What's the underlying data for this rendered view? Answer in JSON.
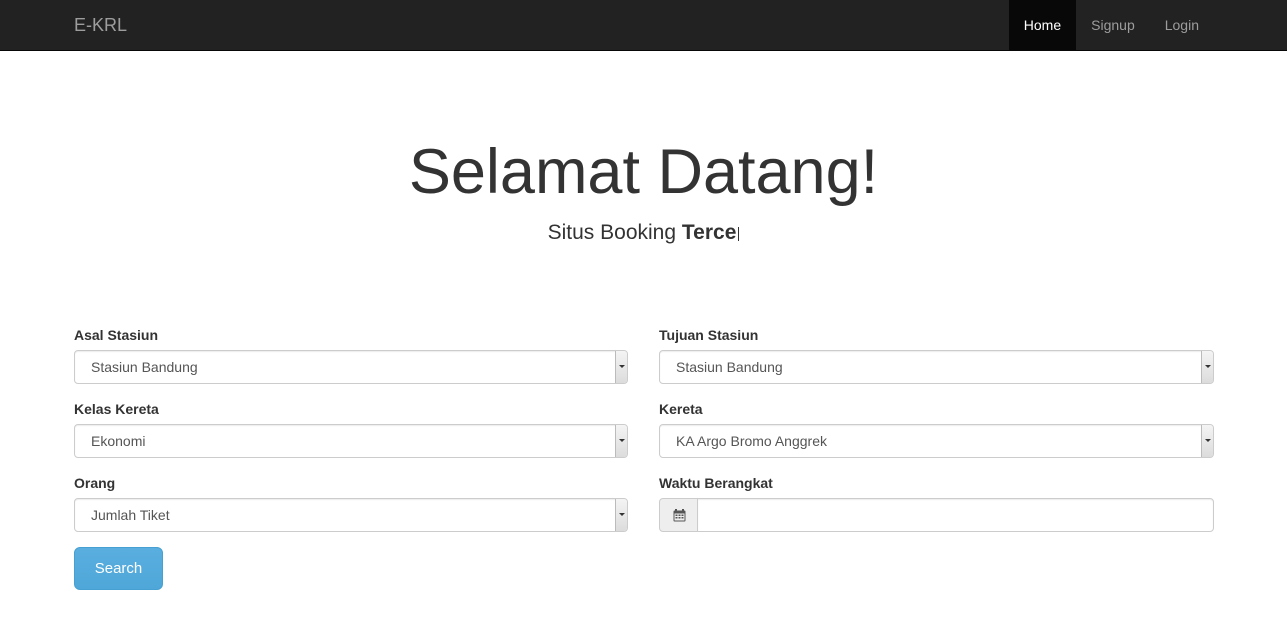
{
  "navbar": {
    "brand": "E-KRL",
    "items": [
      {
        "label": "Home",
        "active": true
      },
      {
        "label": "Signup",
        "active": false
      },
      {
        "label": "Login",
        "active": false
      }
    ]
  },
  "hero": {
    "title": "Selamat Datang!",
    "subtitle_prefix": "Situs Booking",
    "subtitle_typed": "Terce"
  },
  "form": {
    "asal_stasiun": {
      "label": "Asal Stasiun",
      "value": "Stasiun Bandung"
    },
    "tujuan_stasiun": {
      "label": "Tujuan Stasiun",
      "value": "Stasiun Bandung"
    },
    "kelas_kereta": {
      "label": "Kelas Kereta",
      "value": "Ekonomi"
    },
    "kereta": {
      "label": "Kereta",
      "value": "KA Argo Bromo Anggrek"
    },
    "orang": {
      "label": "Orang",
      "value": "Jumlah Tiket"
    },
    "waktu_berangkat": {
      "label": "Waktu Berangkat",
      "value": "",
      "icon": "calendar-icon"
    },
    "search_label": "Search"
  },
  "colors": {
    "navbar_bg": "#222222",
    "nav_active_bg": "#080808",
    "search_button": "#5aaee0"
  }
}
